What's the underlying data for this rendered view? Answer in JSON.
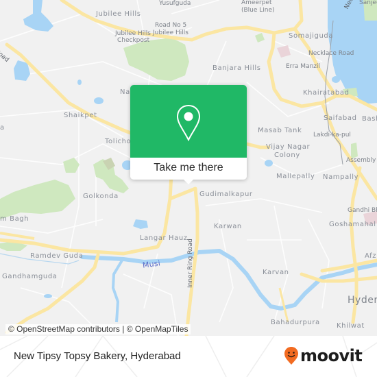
{
  "map": {
    "colors": {
      "land": "#f1f1f1",
      "road": "#fbe6a2",
      "water": "#a8d4f5",
      "park": "#cfe8bf",
      "popup": "#20b866",
      "brand_pin": "#f26b21"
    },
    "labels": {
      "jubilee_hills": "Jubilee Hills",
      "yusufguda": "Yusufguda",
      "ameerpet": "Ameerpet",
      "ameerpet_line": "(Blue Line)",
      "road_no_5": "Road No 5",
      "road_no_5_sub": "Jubilee Hills",
      "jh_checkpost": "Jubilee Hills",
      "jh_checkpost_sub": "Checkpost",
      "somajiguda": "Somajiguda",
      "necklace_road": "Necklace Road",
      "necklace_rd_vertical": "Necklace",
      "sanjeevaiah": "Sanjee",
      "banjara_hills": "Banjara Hills",
      "erra_manzil": "Erra Manzil",
      "khairatabad": "Khairatabad",
      "road_left": "Road",
      "nampally_partial": "Na",
      "shaikpet": "Shaikpet",
      "tolichowki": "Tolicho",
      "saifabad": "Saifabad",
      "bash": "Bash",
      "masab_tank": "Masab Tank",
      "lakdi_ka_pul": "Lakdi-ka-pul",
      "vijay_nagar": "Vijay Nagar",
      "vijay_nagar_sub": "Colony",
      "assembly": "Assembly",
      "mallepally": "Mallepally",
      "nampally": "Nampally",
      "golkonda": "Golkonda",
      "gudimalkapur": "Gudimalkapur",
      "gandhi_bhavan": "Gandhi Bh",
      "goshamahal": "Goshamahal",
      "karwan": "Karwan",
      "bagh": "m Bagh",
      "langar_hauz": "Langar Hauz",
      "inner_ring_road": "Inner Ring Road",
      "ramdev_guda": "Ramdev Guda",
      "musi": "Musi",
      "afzal": "Afz",
      "gandhamguda": "Gandhamguda",
      "karvan": "Karvan",
      "hyderabad": "Hyder",
      "bahadurpura": "Bahadurpura",
      "khilwat": "Khilwat",
      "left_a": "a"
    },
    "attribution": "© OpenStreetMap contributors | © OpenMapTiles"
  },
  "popup": {
    "icon": "location-pin-icon",
    "action_label": "Take me there"
  },
  "footer": {
    "place_title": "New Tipsy Topsy Bakery, Hyderabad",
    "brand_name": "moovit",
    "brand_icon": "moovit-smiley-pin-icon"
  }
}
